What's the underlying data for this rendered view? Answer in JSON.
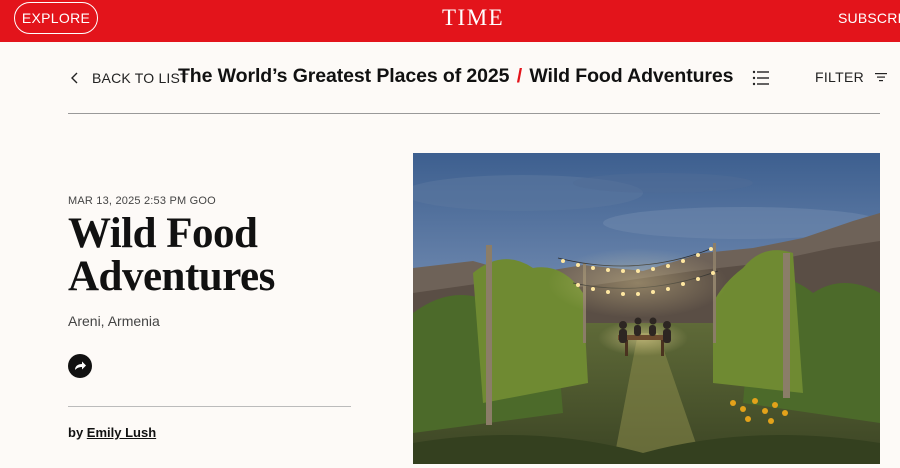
{
  "header": {
    "explore_label": "EXPLORE",
    "logo": "TIME",
    "subscribe_label": "SUBSCRIBE",
    "brand_color": "#e3141b"
  },
  "nav": {
    "back_label": "BACK TO LIST",
    "list_title": "The World’s Greatest Places of 2025",
    "separator": "/",
    "current_title": "Wild Food Adventures",
    "filter_label": "FILTER",
    "icons": [
      "chevron-left-icon",
      "list-icon",
      "filter-icon"
    ]
  },
  "article": {
    "dateline": "MAR 13, 2025 2:53 PM GOO",
    "title": "Wild Food Adventures",
    "location": "Areni, Armenia",
    "byline_prefix": "by",
    "author": "Emily Lush",
    "share_icon": "share-icon"
  },
  "hero_image": {
    "description_icon": "photo-vineyard-dinner"
  }
}
